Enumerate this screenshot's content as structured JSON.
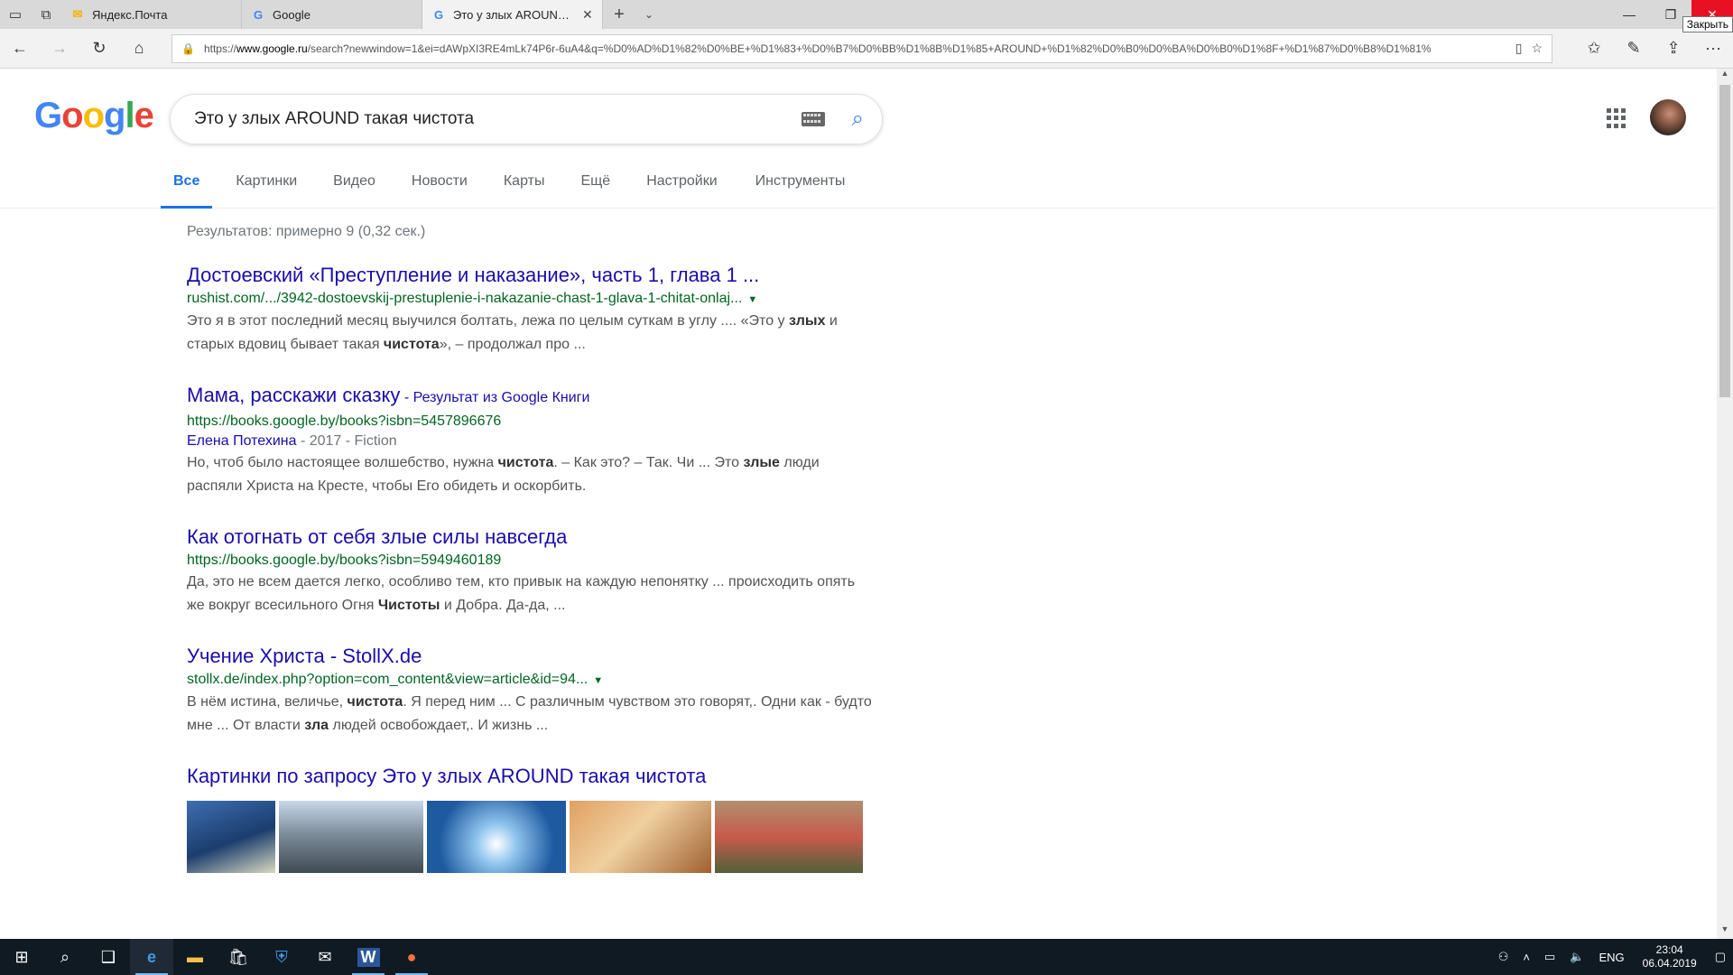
{
  "browser": {
    "tabs": [
      {
        "label": "Яндекс.Почта",
        "favicon": "mail-icon",
        "color": "#f4b400"
      },
      {
        "label": "Google",
        "favicon": "google-g-icon",
        "color": "#4285f4"
      },
      {
        "label": "Это у злых AROUND та",
        "favicon": "google-g-icon",
        "color": "#4285f4"
      }
    ],
    "close_tooltip": "Закрыть",
    "url_prefix": "https://",
    "url_host": "www.google.ru",
    "url_rest": "/search?newwindow=1&ei=dAWpXI3RE4mLk74P6r-6uA4&q=%D0%AD%D1%82%D0%BE+%D1%83+%D0%B7%D0%BB%D1%8B%D1%85+AROUND+%D1%82%D0%B0%D0%BA%D0%B0%D1%8F+%D1%87%D0%B8%D1%81%"
  },
  "google": {
    "logo_letters": [
      {
        "ch": "G",
        "color": "#4285f4"
      },
      {
        "ch": "o",
        "color": "#ea4335"
      },
      {
        "ch": "o",
        "color": "#fbbc05"
      },
      {
        "ch": "g",
        "color": "#4285f4"
      },
      {
        "ch": "l",
        "color": "#34a853"
      },
      {
        "ch": "e",
        "color": "#ea4335"
      }
    ],
    "query": "Это у злых AROUND такая чистота",
    "tabs": [
      "Все",
      "Картинки",
      "Видео",
      "Новости",
      "Карты",
      "Ещё",
      "Настройки",
      "Инструменты"
    ],
    "stats": "Результатов: примерно 9 (0,32 сек.)",
    "results": [
      {
        "title": "Достоевский «Преступление и наказание», часть 1, глава 1 ...",
        "url": "rushist.com/.../3942-dostoevskij-prestuplenie-i-nakazanie-chast-1-glava-1-chitat-onlaj...",
        "has_arrow": true,
        "snippet": "Это я в этот последний месяц выучился болтать, лежа по целым суткам в углу .... «Это у <b>злых</b> и старых вдовиц бывает такая <b>чистота</b>», – продолжал про ..."
      },
      {
        "title": "Мама, расскажи сказку",
        "title_suffix": " - Результат из Google Книги",
        "url": "https://books.google.by/books?isbn=5457896676",
        "has_arrow": false,
        "author": "Елена Потехина",
        "meta": " - 2017 - Fiction",
        "snippet": "Но, чтоб было настоящее волшебство, нужна <b>чистота</b>. – Как это? – Так. Чи ... Это <b>злые</b> люди распяли Христа на Кресте, чтобы Его обидеть и оскорбить."
      },
      {
        "title": "Как отогнать от себя злые силы навсегда",
        "url": "https://books.google.by/books?isbn=5949460189",
        "has_arrow": false,
        "snippet": "Да, это не всем дается легко, особливо тем, кто привык на каждую непонятку ... происходить опять же вокруг всесильного Огня <b>Чистоты</b> и Добра. Да-да, ..."
      },
      {
        "title": "Учение Христа - StollX.de",
        "url": "stollx.de/index.php?option=com_content&view=article&id=94...",
        "has_arrow": true,
        "snippet": "В нём истина, величье, <b>чистота</b>. Я перед ним ... С различным чувством это говорят,. Одни как - будто мне ... От власти <b>зла</b> людей освобождает,. И жизнь ..."
      }
    ],
    "images_heading": "Картинки по запросу Это у злых AROUND такая чистота",
    "thumbnails": [
      {
        "w": 98,
        "bg": "linear-gradient(160deg,#3d6fb0 0%,#1b3d6e 55%,#d9d9c0 100%)"
      },
      {
        "w": 160,
        "bg": "linear-gradient(180deg,#c8d8e8 0%,#7f8e9c 45%,#3f4a52 100%)"
      },
      {
        "w": 154,
        "bg": "radial-gradient(circle at 50% 60%,#ffffff 0,#8fc4ee 25%,#1e5aa0 70%)"
      },
      {
        "w": 157,
        "bg": "linear-gradient(135deg,#e0a060 0%,#f0d0a0 45%,#a06030 100%)"
      },
      {
        "w": 164,
        "bg": "linear-gradient(180deg,#b09070 0%,#c85a4a 50%,#50603a 100%)"
      }
    ]
  },
  "taskbar": {
    "lang": "ENG",
    "time": "23:04",
    "date": "06.04.2019"
  }
}
